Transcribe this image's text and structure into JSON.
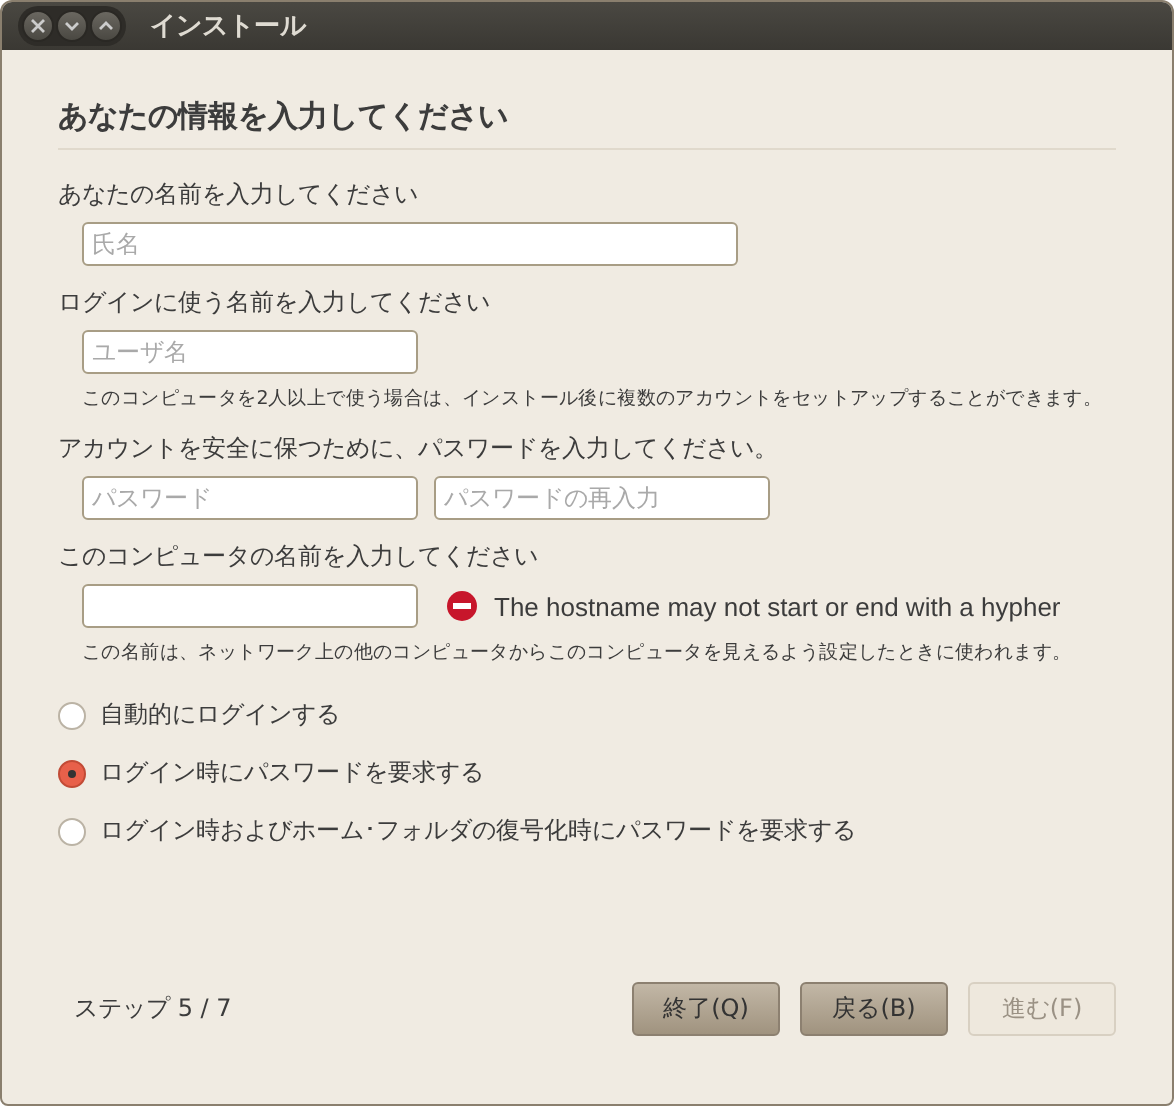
{
  "window": {
    "title": "インストール"
  },
  "heading": "あなたの情報を入力してください",
  "sections": [
    {
      "label": "あなたの名前を入力してください",
      "fields": [
        {
          "placeholder": "氏名",
          "wide": true
        }
      ]
    },
    {
      "label": "ログインに使う名前を入力してください",
      "fields": [
        {
          "placeholder": "ユーザ名",
          "wide": false
        }
      ],
      "hint": "このコンピュータを2人以上で使う場合は、インストール後に複数のアカウントをセットアップすることができます。"
    },
    {
      "label": "アカウントを安全に保つために、パスワードを入力してください。",
      "fields": [
        {
          "placeholder": "パスワード",
          "wide": false
        },
        {
          "placeholder": "パスワードの再入力",
          "wide": false
        }
      ]
    },
    {
      "label": "このコンピュータの名前を入力してください",
      "fields": [
        {
          "wide": false
        }
      ],
      "error": "The hostname may not start or end with a hypher",
      "hint": "この名前は、ネットワーク上の他のコンピュータからこのコンピュータを見えるよう設定したときに使われます。"
    }
  ],
  "login_options": [
    {
      "label": "自動的にログインする",
      "selected": false
    },
    {
      "label": "ログイン時にパスワードを要求する",
      "selected": true
    },
    {
      "label": "ログイン時およびホーム･フォルダの復号化時にパスワードを要求する",
      "selected": false
    }
  ],
  "step": "ステップ 5 / 7",
  "buttons": [
    {
      "label": "終了(Q)",
      "disabled": false
    },
    {
      "label": "戻る(B)",
      "disabled": false
    },
    {
      "label": "進む(F)",
      "disabled": true
    }
  ]
}
